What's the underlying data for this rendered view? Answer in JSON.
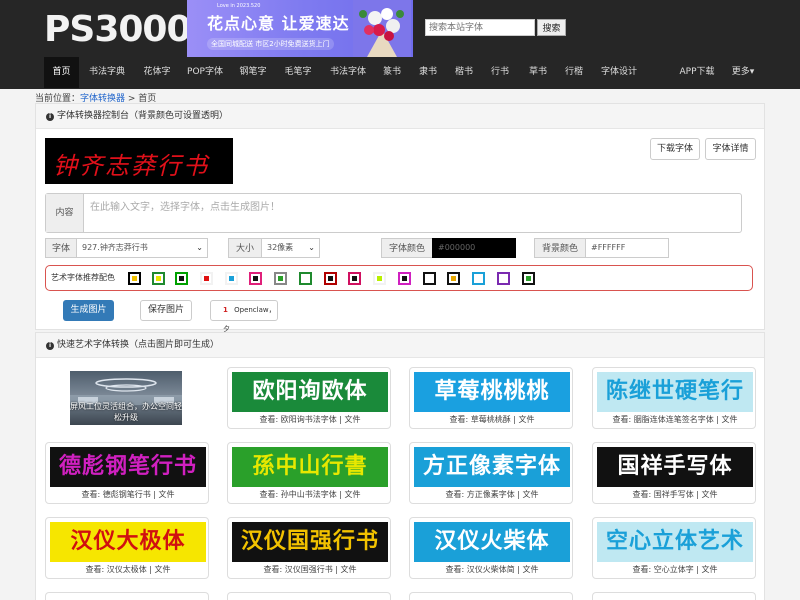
{
  "header": {
    "logo": "PS3000",
    "ad": {
      "top": "Love in 2023.520",
      "title": "花点心意 让爱速达",
      "sub": "全国同城配送 市区2小时免费送货上门"
    },
    "search_placeholder": "搜索本站字体",
    "search_button": "搜索"
  },
  "nav": [
    "首页",
    "书法字典",
    "花体字",
    "POP字体",
    "钢笔字",
    "毛笔字",
    "书法字体",
    "篆书",
    "隶书",
    "楷书",
    "行书",
    "草书",
    "行楷",
    "字体设计",
    "APP下载",
    "更多▾"
  ],
  "breadcrumb": {
    "prefix": "当前位置：",
    "link": "字体转换器",
    "sep": " > ",
    "current": "首页"
  },
  "console": {
    "title": "字体转换器控制台（背景颜色可设置透明）",
    "preview_text": "钟齐志莽行书",
    "download_font": "下载字体",
    "font_detail": "字体详情",
    "content_label": "内容",
    "content_placeholder": "在此输入文字，选择字体，点击生成图片！",
    "font_label": "字体",
    "font_value": "927.钟齐志莽行书",
    "size_label": "大小",
    "size_value": "32像素",
    "font_color_label": "字体颜色",
    "font_color_value": "#000000",
    "bg_color_label": "背景颜色",
    "bg_color_value": "#FFFFFF",
    "art_colors_label": "艺术字体推荐配色",
    "swatches": [
      {
        "border": "#000000",
        "fill": "#f2c200"
      },
      {
        "border": "#1f8a2e",
        "fill": "#e8e800"
      },
      {
        "border": "#00a000",
        "fill": "#111111"
      },
      {
        "border": "#f2f2f2",
        "fill": "#e01010"
      },
      {
        "border": "#f2f2f2",
        "fill": "#1aa0d8"
      },
      {
        "border": "#e0207a",
        "fill": "#111111"
      },
      {
        "border": "#888888",
        "fill": "#2aa02a"
      },
      {
        "border": "#1f8a2e",
        "fill": "#ffffff"
      },
      {
        "border": "#b00000",
        "fill": "#111111"
      },
      {
        "border": "#d01060",
        "fill": "#111111"
      },
      {
        "border": "#f2f2f2",
        "fill": "#b8f000"
      },
      {
        "border": "#d020c0",
        "fill": "#111111"
      },
      {
        "border": "#111111",
        "fill": "#ffffff"
      },
      {
        "border": "#111111",
        "fill": "#e8a800"
      },
      {
        "border": "#1aa0d8",
        "fill": "#ffffff"
      },
      {
        "border": "#7a2ab0",
        "fill": "#ffffff"
      },
      {
        "border": "#111111",
        "fill": "#2aa02a"
      }
    ],
    "generate": "生成图片",
    "save": "保存图片",
    "share_count": "1",
    "share_text": "Openclaw，夕"
  },
  "gallery": {
    "title": "快速艺术字体转换（点击图片即可生成）",
    "ad_photo_text": "屏风工位灵活组合，办公空间轻松升级",
    "tiles": [
      {
        "text": "欧阳询欧体",
        "bg": "#1a8a3a",
        "fg": "#ffffff",
        "caption": "查看: 欧阳询书法字体 | 文件"
      },
      {
        "text": "草莓桃桃桃",
        "bg": "#1aa0e0",
        "fg": "#ffffff",
        "caption": "查看: 草莓桃桃酥 | 文件"
      },
      {
        "text": "陈继世硬笔行",
        "bg": "#bfe8f2",
        "fg": "#1aa0d8",
        "caption": "查看: 胭脂连体连笔签名字体 | 文件"
      },
      {
        "text": "德彪钢笔行书",
        "bg": "#111111",
        "fg": "#d020c0",
        "caption": "查看: 德彪钢笔行书 | 文件"
      },
      {
        "text": "孫中山行書",
        "bg": "#2aa02a",
        "fg": "#e8e800",
        "caption": "查看: 孙中山书法字体 | 文件"
      },
      {
        "text": "方正像素字体",
        "bg": "#1aa0d8",
        "fg": "#ffffff",
        "caption": "查看: 方正像素字体 | 文件"
      },
      {
        "text": "国祥手写体",
        "bg": "#111111",
        "fg": "#ffffff",
        "caption": "查看: 国祥手写体 | 文件"
      },
      {
        "text": "汉仪大极体",
        "bg": "#f6e600",
        "fg": "#d01010",
        "caption": "查看: 汉仪太极体 | 文件"
      },
      {
        "text": "汉仪国强行书",
        "bg": "#111111",
        "fg": "#f2c200",
        "caption": "查看: 汉仪国强行书 | 文件"
      },
      {
        "text": "汉仪火柴体",
        "bg": "#1aa0d8",
        "fg": "#ffffff",
        "caption": "查看: 汉仪火柴体简 | 文件"
      },
      {
        "text": "空心立体艺术",
        "bg": "#bfe8f2",
        "fg": "#1aa0d8",
        "caption": "查看: 空心立体字 | 文件"
      }
    ]
  }
}
